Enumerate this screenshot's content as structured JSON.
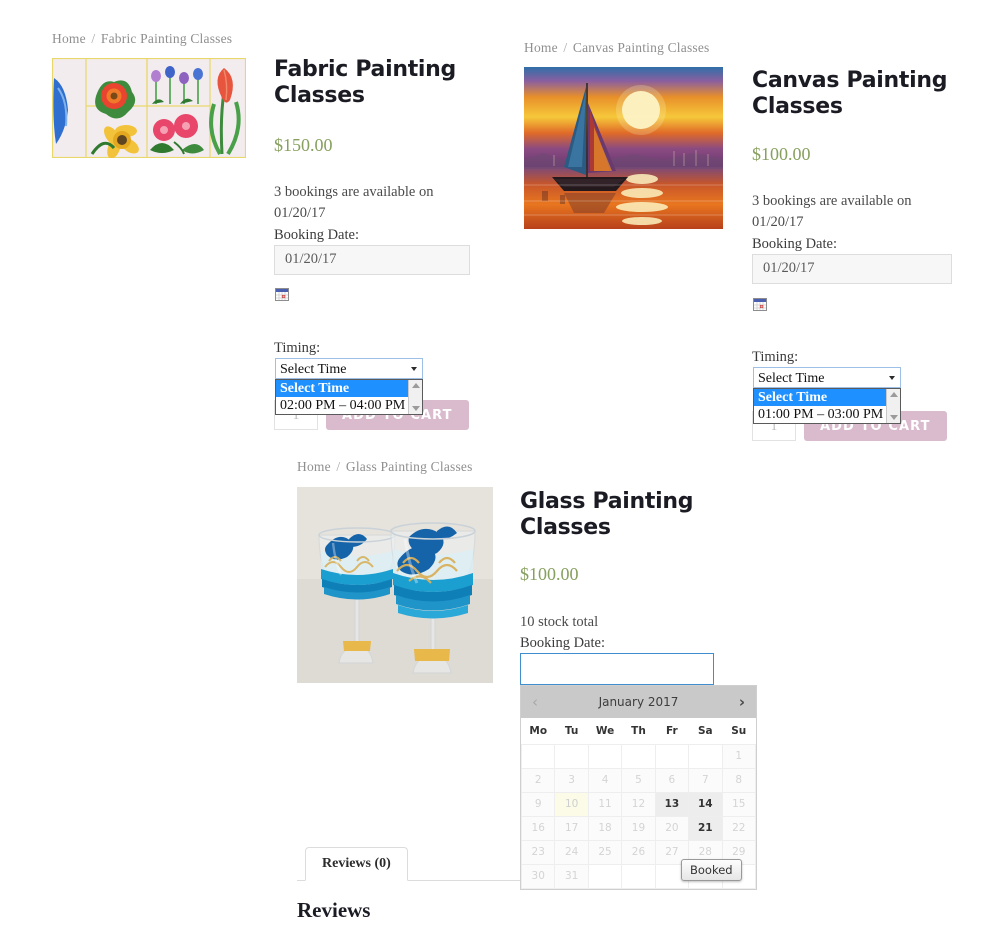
{
  "products": [
    {
      "breadcrumb_home": "Home",
      "breadcrumb_sep": "/",
      "breadcrumb_current": "Fabric Painting Classes",
      "title": "Fabric Painting Classes",
      "price": "$150.00",
      "availability": "3 bookings are available on 01/20/17",
      "booking_date_label": "Booking Date:",
      "booking_date_value": "01/20/17",
      "calendar_icon": "calendar-icon",
      "timing_label": "Timing:",
      "timing_selected": "Select Time",
      "timing_options": [
        "Select Time",
        "02:00 PM – 04:00 PM"
      ],
      "quantity": "1",
      "add_to_cart": "ADD TO CART",
      "image_alt": "fabric-painting-flowers"
    },
    {
      "breadcrumb_home": "Home",
      "breadcrumb_sep": "/",
      "breadcrumb_current": "Canvas Painting Classes",
      "title": "Canvas Painting Classes",
      "price": "$100.00",
      "availability": "3 bookings are available on 01/20/17",
      "booking_date_label": "Booking Date:",
      "booking_date_value": "01/20/17",
      "calendar_icon": "calendar-icon",
      "timing_label": "Timing:",
      "timing_selected": "Select Time",
      "timing_options": [
        "Select Time",
        "01:00 PM – 03:00 PM"
      ],
      "quantity": "1",
      "add_to_cart": "ADD TO CART",
      "image_alt": "canvas-painting-sailboat-sunset"
    },
    {
      "breadcrumb_home": "Home",
      "breadcrumb_sep": "/",
      "breadcrumb_current": "Glass Painting Classes",
      "title": "Glass Painting Classes",
      "price": "$100.00",
      "availability": "10 stock total",
      "booking_date_label": "Booking Date:",
      "booking_date_value": "",
      "image_alt": "glass-painting-dolphin-wine-glasses"
    }
  ],
  "datepicker": {
    "prev_icon": "‹",
    "next_icon": "›",
    "month_title": "January 2017",
    "weekdays": [
      "Mo",
      "Tu",
      "We",
      "Th",
      "Fr",
      "Sa",
      "Su"
    ],
    "weeks": [
      [
        {
          "label": "",
          "state": "blank"
        },
        {
          "label": "",
          "state": "blank"
        },
        {
          "label": "",
          "state": "blank"
        },
        {
          "label": "",
          "state": "blank"
        },
        {
          "label": "",
          "state": "blank"
        },
        {
          "label": "",
          "state": "blank"
        },
        {
          "label": "1",
          "state": "dim"
        }
      ],
      [
        {
          "label": "2",
          "state": "dim"
        },
        {
          "label": "3",
          "state": "dim"
        },
        {
          "label": "4",
          "state": "dim"
        },
        {
          "label": "5",
          "state": "dim"
        },
        {
          "label": "6",
          "state": "dim"
        },
        {
          "label": "7",
          "state": "dim"
        },
        {
          "label": "8",
          "state": "dim"
        }
      ],
      [
        {
          "label": "9",
          "state": "dim"
        },
        {
          "label": "10",
          "state": "today"
        },
        {
          "label": "11",
          "state": "dim"
        },
        {
          "label": "12",
          "state": "dim"
        },
        {
          "label": "13",
          "state": "avail"
        },
        {
          "label": "14",
          "state": "avail"
        },
        {
          "label": "15",
          "state": "dim"
        }
      ],
      [
        {
          "label": "16",
          "state": "dim"
        },
        {
          "label": "17",
          "state": "dim"
        },
        {
          "label": "18",
          "state": "dim"
        },
        {
          "label": "19",
          "state": "dim"
        },
        {
          "label": "20",
          "state": "dim"
        },
        {
          "label": "21",
          "state": "avail"
        },
        {
          "label": "22",
          "state": "dim"
        }
      ],
      [
        {
          "label": "23",
          "state": "dim"
        },
        {
          "label": "24",
          "state": "dim"
        },
        {
          "label": "25",
          "state": "dim"
        },
        {
          "label": "26",
          "state": "dim"
        },
        {
          "label": "27",
          "state": "dim"
        },
        {
          "label": "28",
          "state": "dim"
        },
        {
          "label": "29",
          "state": "dim"
        }
      ],
      [
        {
          "label": "30",
          "state": "dim"
        },
        {
          "label": "31",
          "state": "dim"
        },
        {
          "label": "",
          "state": "blank"
        },
        {
          "label": "",
          "state": "blank"
        },
        {
          "label": "",
          "state": "blank"
        },
        {
          "label": "",
          "state": "blank"
        },
        {
          "label": "",
          "state": "blank"
        }
      ]
    ],
    "tooltip": "Booked"
  },
  "reviews": {
    "tab_label": "Reviews (0)",
    "heading": "Reviews"
  },
  "colors": {
    "price": "#87a05f",
    "add_to_cart_bg": "#d9bbcd",
    "select_highlight": "#1e90ff",
    "focus_border": "#3f8fd0",
    "datepicker_header": "#c9c9c9"
  }
}
